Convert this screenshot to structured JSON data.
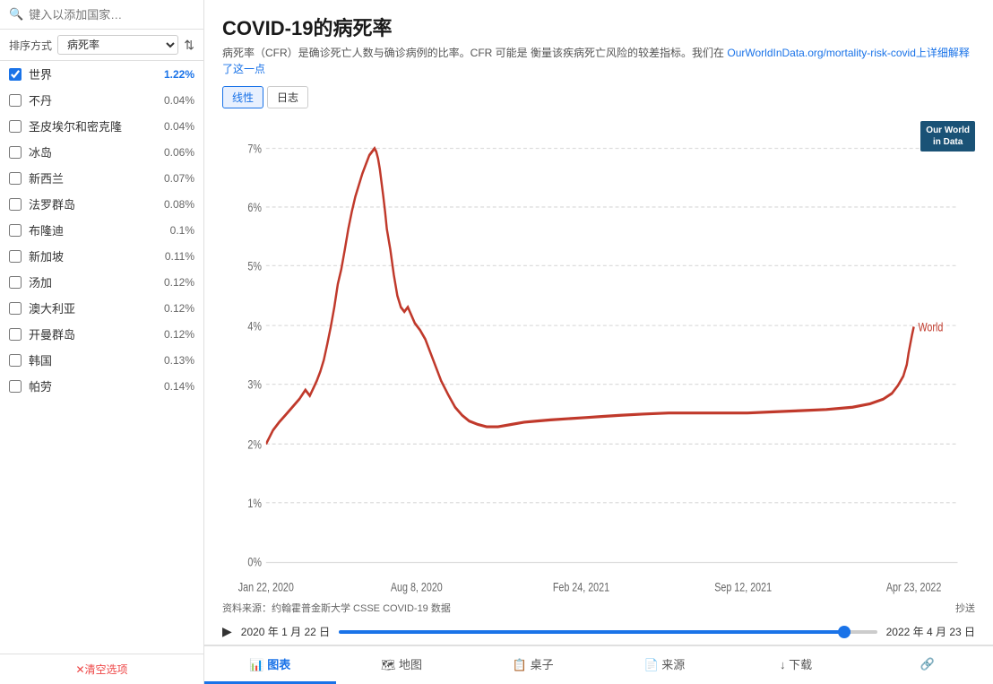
{
  "sidebar": {
    "search_placeholder": "键入以添加国家…",
    "sort_label": "排序方式",
    "sort_value": "病死率",
    "countries": [
      {
        "name": "世界",
        "value": "1.22%",
        "checked": true
      },
      {
        "name": "不丹",
        "value": "0.04%",
        "checked": false
      },
      {
        "name": "圣皮埃尔和密克隆",
        "value": "0.04%",
        "checked": false
      },
      {
        "name": "冰岛",
        "value": "0.06%",
        "checked": false
      },
      {
        "name": "新西兰",
        "value": "0.07%",
        "checked": false
      },
      {
        "name": "法罗群岛",
        "value": "0.08%",
        "checked": false
      },
      {
        "name": "布隆迪",
        "value": "0.1%",
        "checked": false
      },
      {
        "name": "新加坡",
        "value": "0.11%",
        "checked": false
      },
      {
        "name": "汤加",
        "value": "0.12%",
        "checked": false
      },
      {
        "name": "澳大利亚",
        "value": "0.12%",
        "checked": false
      },
      {
        "name": "开曼群岛",
        "value": "0.12%",
        "checked": false
      },
      {
        "name": "韩国",
        "value": "0.13%",
        "checked": false
      },
      {
        "name": "帕劳",
        "value": "0.14%",
        "checked": false
      }
    ],
    "clear_label": "✕清空选项"
  },
  "chart": {
    "title": "COVID-19的病死率",
    "description_1": "病死率（CFR）是确诊死亡人数与确诊病例的比率。CFR 可能是",
    "description_2": "衡量该疾病死亡风险的较差指标。我们在",
    "description_link_text": "OurWorldInData.org/mortality-risk-covid上详细解释了这一点",
    "description_link": "https://ourworldindata.org/mortality-risk-covid",
    "controls": [
      {
        "label": "线性",
        "active": true
      },
      {
        "label": "日志",
        "active": false
      }
    ],
    "x_labels": [
      "Jan 22, 2020",
      "Aug 8, 2020",
      "Feb 24, 2021",
      "Sep 12, 2021",
      "Apr 23, 2022"
    ],
    "y_labels": [
      "0%",
      "1%",
      "2%",
      "3%",
      "4%",
      "5%",
      "6%",
      "7%"
    ],
    "series_label": "World",
    "brand_line1": "Our World",
    "brand_line2": "in Data"
  },
  "timeline": {
    "play_label": "▶",
    "date_start": "2020 年 1 月 22 日",
    "date_end": "2022 年 4 月 23 日",
    "copy_label": "抄送"
  },
  "source": {
    "text": "资料来源：约翰霍普金斯大学 CSSE COVID-19 数据"
  },
  "tabs": [
    {
      "label": "图表",
      "icon": "📊",
      "active": true
    },
    {
      "label": "地图",
      "icon": "🗺",
      "active": false
    },
    {
      "label": "桌子",
      "icon": "📋",
      "active": false
    },
    {
      "label": "来源",
      "icon": "📄",
      "active": false
    },
    {
      "label": "↓ 下载",
      "icon": "",
      "active": false
    },
    {
      "label": "🔗",
      "icon": "",
      "active": false
    }
  ]
}
